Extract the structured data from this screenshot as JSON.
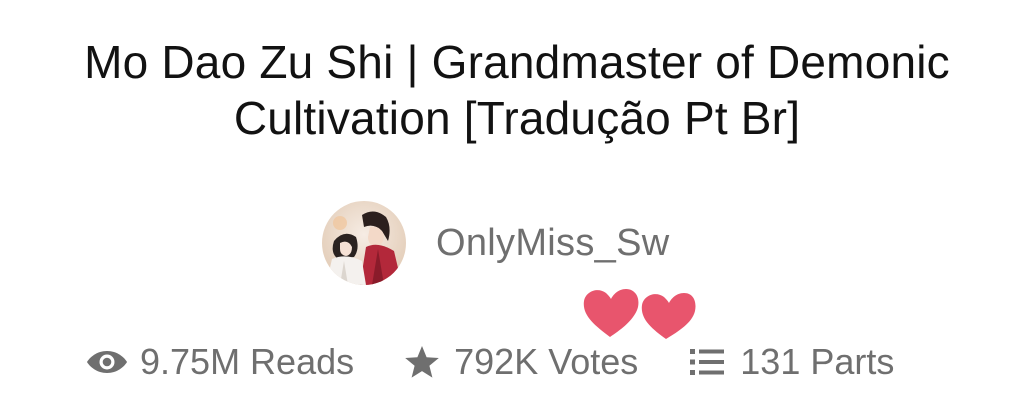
{
  "story": {
    "title_line1": "Mo Dao Zu Shi | Grandmaster of Demonic",
    "title_line2": "Cultivation [Tradução Pt Br]"
  },
  "author": {
    "name": "OnlyMiss_Sw",
    "avatar_icon": "illustrated-avatar"
  },
  "decoration": {
    "icon": "pink-hearts",
    "color": "#e8556d"
  },
  "stats": {
    "reads": {
      "icon": "eye-icon",
      "label": "9.75M Reads"
    },
    "votes": {
      "icon": "star-icon",
      "label": "792K Votes"
    },
    "parts": {
      "icon": "list-icon",
      "label": "131 Parts"
    }
  },
  "colors": {
    "title": "#121212",
    "secondary_text": "#6f6f6f",
    "icon": "#6f6f6f"
  }
}
